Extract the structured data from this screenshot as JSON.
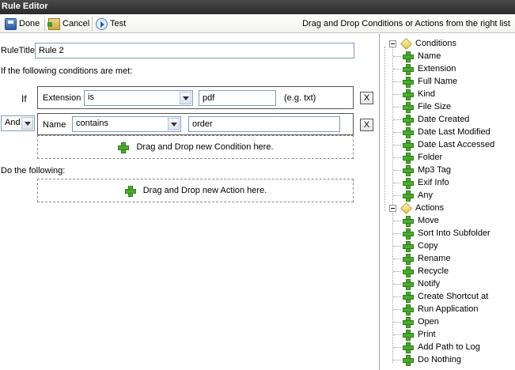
{
  "window": {
    "title": "Rule Editor"
  },
  "toolbar": {
    "done_label": "Done",
    "cancel_label": "Cancel",
    "test_label": "Test",
    "hint": "Drag and Drop Conditions or Actions from the right list"
  },
  "rule": {
    "title_label": "RuleTitle:",
    "title_value": "Rule 2",
    "conditions_heading": "If the following conditions are met:",
    "actions_heading": "Do the following:"
  },
  "conditions": [
    {
      "connector": "If",
      "field": "Extension",
      "operator": "is",
      "value": "pdf",
      "hint": "(e.g. txt)",
      "remove": "X"
    },
    {
      "connector": "And",
      "field": "Name",
      "operator": "contains",
      "value": "order",
      "remove": "X"
    }
  ],
  "drop": {
    "condition": "Drag and Drop new Condition here.",
    "action": "Drag and Drop new Action here."
  },
  "tree": {
    "conditions_label": "Conditions",
    "conditions": [
      "Name",
      "Extension",
      "Full Name",
      "Kind",
      "File Size",
      "Date Created",
      "Date Last Modified",
      "Date Last Accessed",
      "Folder",
      "Mp3 Tag",
      "Exif Info",
      "Any"
    ],
    "actions_label": "Actions",
    "actions": [
      "Move",
      "Sort Into Subfolder",
      "Copy",
      "Rename",
      "Recycle",
      "Notify",
      "Create Shortcut at",
      "Run Application",
      "Open",
      "Print",
      "Add Path to Log",
      "Do Nothing"
    ]
  },
  "icons": {
    "done": "save-icon",
    "cancel": "cancel-icon",
    "test": "play-icon",
    "add": "green-plus-icon",
    "group": "cubes-icon"
  },
  "colors": {
    "titlebar": "#2a2a2a",
    "plus_green": "#4caa2f",
    "border": "#7f9db9"
  }
}
